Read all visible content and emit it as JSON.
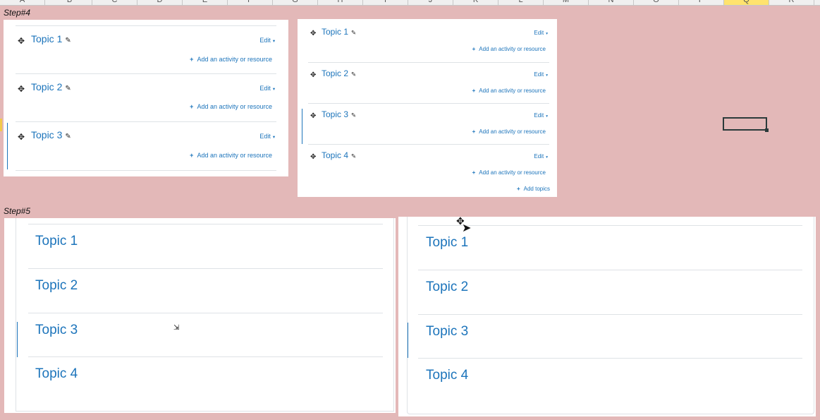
{
  "columns": [
    "A",
    "B",
    "C",
    "D",
    "E",
    "F",
    "G",
    "H",
    "I",
    "J",
    "K",
    "L",
    "M",
    "N",
    "O",
    "P",
    "Q",
    "R"
  ],
  "selected_column": "Q",
  "step4": {
    "label": "Step#4",
    "left_panel": {
      "topics": [
        {
          "title": "Topic 1",
          "edit": "Edit",
          "add": "Add an activity or resource"
        },
        {
          "title": "Topic 2",
          "edit": "Edit",
          "add": "Add an activity or resource"
        },
        {
          "title": "Topic 3",
          "edit": "Edit",
          "add": "Add an activity or resource"
        }
      ]
    },
    "right_panel": {
      "topics": [
        {
          "title": "Topic 1",
          "edit": "Edit",
          "add": "Add an activity or resource"
        },
        {
          "title": "Topic 2",
          "edit": "Edit",
          "add": "Add an activity or resource"
        },
        {
          "title": "Topic 3",
          "edit": "Edit",
          "add": "Add an activity or resource"
        },
        {
          "title": "Topic 4",
          "edit": "Edit",
          "add": "Add an activity or resource"
        }
      ],
      "add_topics": "Add topics"
    }
  },
  "step5": {
    "label": "Step#5",
    "left_panel": {
      "topics": [
        "Topic 1",
        "Topic 2",
        "Topic 3",
        "Topic 4"
      ]
    },
    "right_panel": {
      "topics": [
        "Topic 1",
        "Topic 2",
        "Topic 3",
        "Topic 4"
      ]
    }
  },
  "icons": {
    "move": "move-icon",
    "pencil": "pencil-icon",
    "caret": "caret-down-icon",
    "plus": "plus-icon",
    "cursor": "pointer-cursor-icon"
  },
  "colors": {
    "background": "#e3b8b8",
    "link": "#1c74bb",
    "divider": "#dee2e6"
  }
}
